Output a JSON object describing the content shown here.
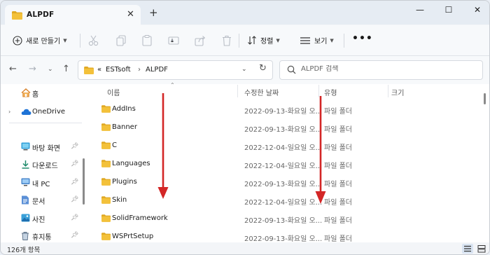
{
  "window": {
    "tab_title": "ALPDF",
    "tab_close": "✕",
    "new_tab": "+",
    "minimize": "—",
    "maximize": "☐",
    "close": "✕"
  },
  "commandbar": {
    "new_label": "새로 만들기",
    "sort_label": "정렬",
    "view_label": "보기",
    "more_label": "•••"
  },
  "navigation": {
    "breadcrumb_overflow": "«",
    "crumbs": [
      "ESTsoft",
      "ALPDF"
    ],
    "separator": "›",
    "search_placeholder": "ALPDF 검색"
  },
  "sidebar": {
    "items": [
      {
        "label": "홈",
        "icon": "home-icon"
      },
      {
        "label": "OneDrive",
        "icon": "cloud-icon"
      },
      {
        "label": "바탕 화면",
        "icon": "desktop-icon"
      },
      {
        "label": "다운로드",
        "icon": "download-icon"
      },
      {
        "label": "내 PC",
        "icon": "monitor-icon"
      },
      {
        "label": "문서",
        "icon": "document-icon"
      },
      {
        "label": "사진",
        "icon": "picture-icon"
      },
      {
        "label": "휴지통",
        "icon": "recycle-bin-icon"
      }
    ]
  },
  "columns": {
    "name": "이름",
    "date": "수정한 날짜",
    "type": "유형",
    "size": "크기"
  },
  "files": [
    {
      "name": "AddIns",
      "date": "2022-09-13-화요일 오...",
      "type": "파일 폴더"
    },
    {
      "name": "Banner",
      "date": "2022-09-13-화요일 오...",
      "type": "파일 폴더"
    },
    {
      "name": "C",
      "date": "2022-12-04-일요일 오...",
      "type": "파일 폴더"
    },
    {
      "name": "Languages",
      "date": "2022-12-04-일요일 오...",
      "type": "파일 폴더"
    },
    {
      "name": "Plugins",
      "date": "2022-09-13-화요일 오...",
      "type": "파일 폴더"
    },
    {
      "name": "Skin",
      "date": "2022-12-04-일요일 오...",
      "type": "파일 폴더"
    },
    {
      "name": "SolidFramework",
      "date": "2022-09-13-화요일 오...",
      "type": "파일 폴더"
    },
    {
      "name": "WSPrtSetup",
      "date": "2022-09-13-화요일 오...",
      "type": "파일 폴더"
    }
  ],
  "status": {
    "item_count": "126개 항목"
  },
  "colors": {
    "folder": "#f3c13a",
    "folder_dark": "#e0a823",
    "annotation_arrow": "#d32626",
    "accent": "#2a6fdb"
  }
}
